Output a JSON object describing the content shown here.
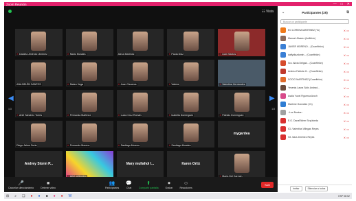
{
  "window": {
    "title": "Zoom Reunión",
    "controls": [
      "—",
      "□",
      "✕"
    ]
  },
  "gallery": {
    "view_label": "☷ Vista",
    "page_left": "1/3",
    "page_right": "1/3",
    "tiles": [
      {
        "name": "Daniela Jiménez Jiménez",
        "muted": true,
        "kind": "person"
      },
      {
        "name": "Mario Morales",
        "muted": true,
        "kind": "person"
      },
      {
        "name": "Alexa Martínez",
        "muted": false,
        "kind": "person"
      },
      {
        "name": "Paola Díaz",
        "muted": true,
        "kind": "person"
      },
      {
        "name": "Liam Santos",
        "muted": true,
        "kind": "red"
      },
      {
        "name": "ANA BELÉN SANTOS",
        "muted": false,
        "kind": "person"
      },
      {
        "name": "Mateo Vega",
        "muted": true,
        "kind": "person"
      },
      {
        "name": "Juan Cisneros",
        "muted": true,
        "kind": "person"
      },
      {
        "name": "Valeria",
        "muted": true,
        "kind": "person"
      },
      {
        "name": "Valentina Hernández",
        "muted": true,
        "kind": "photo"
      },
      {
        "name": "Ariel Sánchez Torres",
        "muted": true,
        "kind": "person"
      },
      {
        "name": "Fernanda Martínez",
        "muted": true,
        "kind": "person"
      },
      {
        "name": "Lucía Cruz Román",
        "muted": true,
        "kind": "person"
      },
      {
        "name": "Isabella Domínguez",
        "muted": true,
        "kind": "person"
      },
      {
        "name": "Patricio Domínguez",
        "muted": true,
        "kind": "person"
      },
      {
        "name": "Diego Jaime Soria",
        "muted": false,
        "kind": "person"
      },
      {
        "name": "Fernando Moreno",
        "muted": true,
        "kind": "person"
      },
      {
        "name": "Santiago Moreno",
        "muted": true,
        "kind": "person"
      },
      {
        "name": "Santiago Morales",
        "muted": true,
        "kind": "person"
      },
      {
        "name": "",
        "muted": false,
        "kind": "text",
        "label": "mygardea"
      },
      {
        "name": "",
        "muted": false,
        "kind": "text",
        "label": "Andrey Storm P..."
      },
      {
        "name": "Ariel pellegrino",
        "muted": true,
        "kind": "art"
      },
      {
        "name": "",
        "muted": false,
        "kind": "text",
        "label": "Mary mullahol I..."
      },
      {
        "name": "",
        "muted": false,
        "kind": "text",
        "label": "Karen Ortiz"
      },
      {
        "name": "María Del Carmen",
        "muted": true,
        "kind": "person"
      }
    ]
  },
  "toolbar": {
    "left": [
      {
        "icon": "🎤",
        "label": "Cancelar silenciamiento",
        "icon_name": "microphone-icon"
      },
      {
        "icon": "■",
        "label": "Detener video",
        "icon_name": "video-camera-icon"
      }
    ],
    "middle": [
      {
        "icon": "👥",
        "label": "Participantes",
        "icon_name": "participants-icon",
        "green": false
      },
      {
        "icon": "💬",
        "label": "Chat",
        "icon_name": "chat-icon",
        "green": false
      },
      {
        "icon": "⬆",
        "label": "Compartir pantalla",
        "icon_name": "share-screen-icon",
        "green": true
      },
      {
        "icon": "⏺",
        "label": "Grabar",
        "icon_name": "record-icon",
        "green": false
      },
      {
        "icon": "☺",
        "label": "Reacciones",
        "icon_name": "reactions-icon",
        "green": false
      }
    ],
    "end_label": "Salir"
  },
  "participants_panel": {
    "title": "Participantes (25)",
    "search_placeholder": "Buscar un participante",
    "rows": [
      {
        "name": "EG LORENA MARTÍNEZ (Yo)",
        "color": "#ef7a1a"
      },
      {
        "name": "Manuel Álvarez (Anfitrión)",
        "color": "#8a6a5a"
      },
      {
        "name": "JAVIER MORENO... (Coanfitrión)",
        "color": "#3a7fd5"
      },
      {
        "name": "daffydiazdomin... (Coanfitrión)",
        "color": "#3a7fd5"
      },
      {
        "name": "Sra. Alicia Delgad... (Coanfitrión)",
        "color": "#d64b2c"
      },
      {
        "name": "Andrea Fabiola G... (Coanfitrión)",
        "color": "#c0392b"
      },
      {
        "name": "SOCIO MARTÍNEZ (Coanfitrión)",
        "color": "#e06a2a"
      },
      {
        "name": "Yesenia Laura Solís Andrad...",
        "color": "#6a4a3a"
      },
      {
        "name": "Asdia Yuval Figueroa Aroch",
        "color": "#d84a8a"
      },
      {
        "name": "Marlene González (Yo)",
        "color": "#2f7dd3"
      },
      {
        "name": "~Luz Bustos~",
        "color": "#a0a0a0"
      },
      {
        "name": "E.G. DanaRicher Sepúlveda",
        "color": "#d93030"
      },
      {
        "name": "ICL Valentina Villegas Reyes",
        "color": "#d93030"
      },
      {
        "name": "IVL Sara Jiménez Reyes",
        "color": "#d93030"
      }
    ],
    "footer": {
      "invite": "Invitar",
      "mute_all": "Silenciar a todos"
    }
  },
  "taskbar": {
    "items": [
      {
        "glyph": "⊞",
        "tone": "",
        "name": "start-icon"
      },
      {
        "glyph": "⌕",
        "tone": "",
        "name": "search-icon"
      },
      {
        "glyph": "❏",
        "tone": "",
        "name": "task-view-icon"
      },
      {
        "glyph": "●",
        "tone": "red",
        "name": "chrome-icon"
      },
      {
        "glyph": "●",
        "tone": "blue",
        "name": "edge-icon"
      },
      {
        "glyph": "■",
        "tone": "",
        "name": "file-explorer-icon"
      },
      {
        "glyph": "●",
        "tone": "pink",
        "name": "zoom-app-icon"
      },
      {
        "glyph": "●",
        "tone": "red",
        "name": "office-icon"
      },
      {
        "glyph": "W",
        "tone": "blue",
        "name": "word-icon"
      }
    ],
    "tray": "ESP  08:52"
  }
}
